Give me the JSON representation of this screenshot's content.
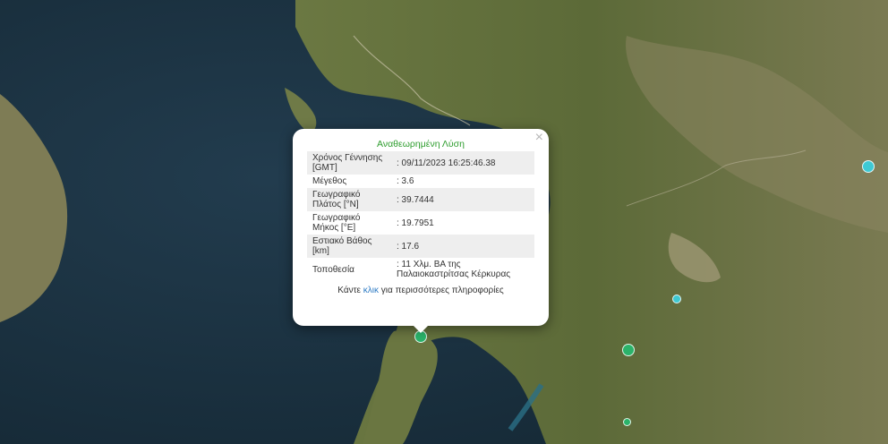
{
  "popup": {
    "heading": "Αναθεωρημένη Λύση",
    "close_glyph": "×",
    "rows": [
      {
        "label": "Χρόνος Γέννησης [GMT]",
        "value": ": 09/11/2023 16:25:46.38"
      },
      {
        "label": "Μέγεθος",
        "value": ": 3.6"
      },
      {
        "label": "Γεωγραφικό Πλάτος [°N]",
        "value": ": 39.7444"
      },
      {
        "label": "Γεωγραφικό Μήκος [°E]",
        "value": ": 19.7951"
      },
      {
        "label": "Εστιακό Βάθος [km]",
        "value": ": 17.6"
      },
      {
        "label": "Τοποθεσία",
        "value": ": 11 Χλμ. ΒΑ της Παλαιοκαστρίτσας Κέρκυρας"
      }
    ],
    "more_prefix": "Κάντε ",
    "more_link": "κλικ",
    "more_suffix": " για περισσότερες πληροφορίες"
  },
  "colors": {
    "sea": "#1b3140",
    "land": "#5d6b3a",
    "marker_cyan": "#3ec9d3",
    "marker_green": "#2bb36a",
    "popup_heading": "#2e9d2e",
    "link": "#2e7bc4"
  }
}
